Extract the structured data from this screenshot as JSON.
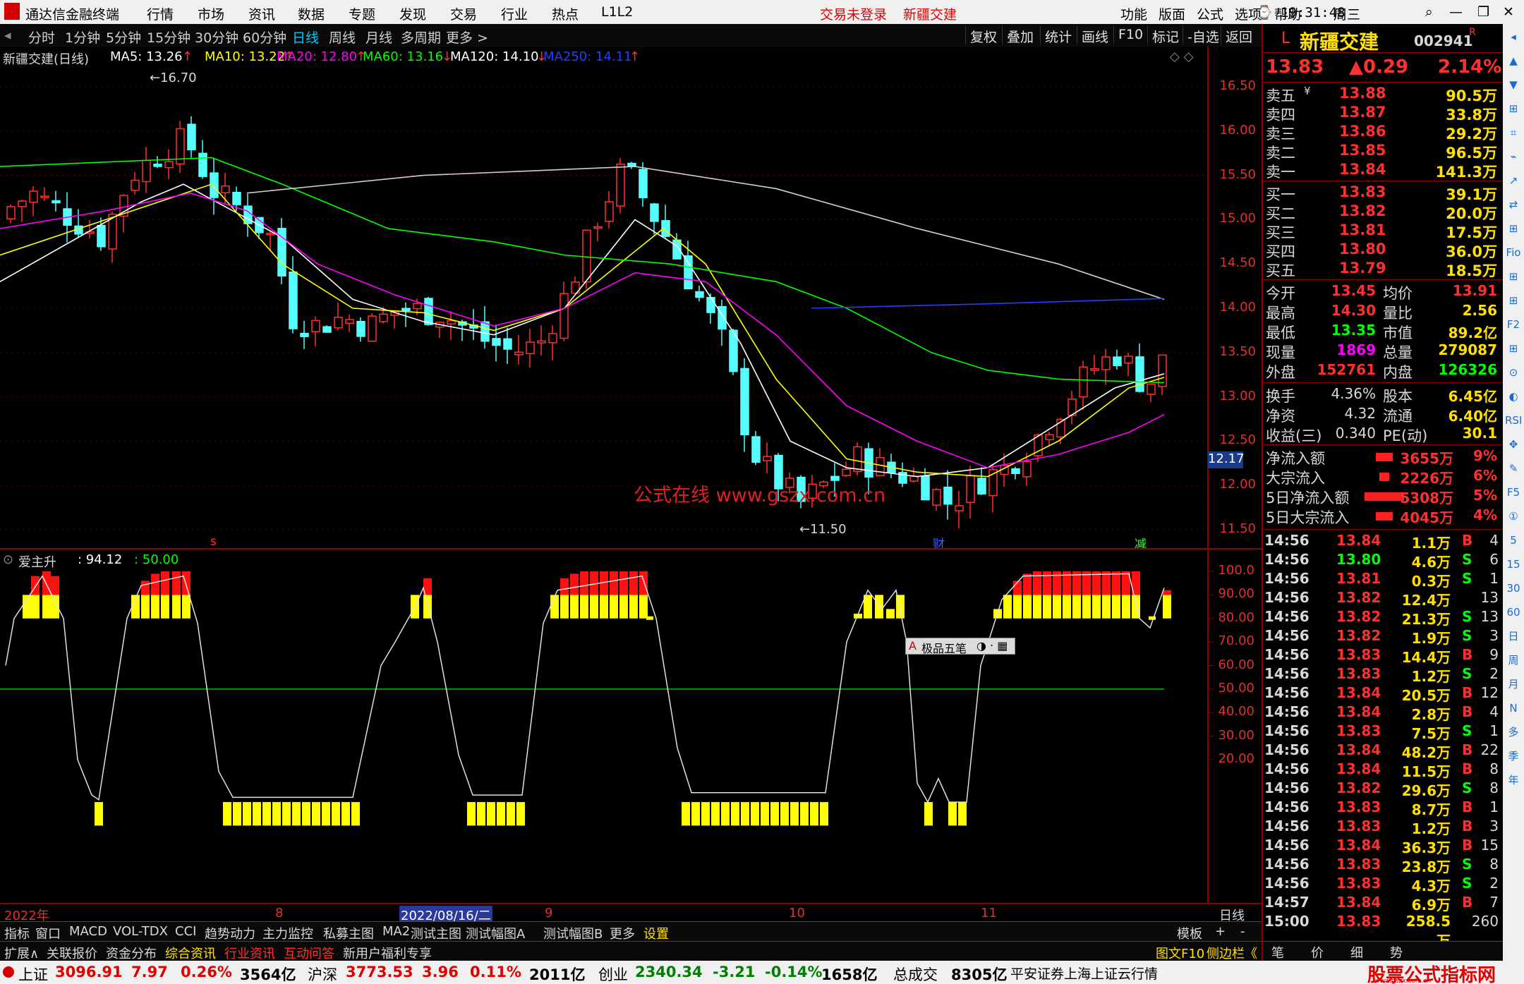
{
  "titlebar": {
    "app": "通达信金融终端",
    "menu": [
      "行情",
      "市场",
      "资讯",
      "数据",
      "专题",
      "发现",
      "交易",
      "行业",
      "热点",
      "L1L2"
    ],
    "trade_status": "交易未登录",
    "stock": "新疆交建",
    "right_menu": [
      "功能",
      "版面",
      "公式",
      "选项",
      "帮助"
    ],
    "time": "19:31:48",
    "weekday": "周三"
  },
  "periods": [
    "分时",
    "1分钟",
    "5分钟",
    "15分钟",
    "30分钟",
    "60分钟",
    "日线",
    "周线",
    "月线",
    "多周期",
    "更多 >"
  ],
  "active_period": "日线",
  "toolbar": [
    "复权",
    "叠加",
    "统计",
    "画线",
    "F10",
    "标记",
    "-自选",
    "返回"
  ],
  "chart": {
    "stock_label": "新疆交建(日线)",
    "ma": [
      {
        "label": "MA5: 13.26",
        "color": "#ffffff",
        "arrow": "↑"
      },
      {
        "label": "MA10: 13.22",
        "color": "#ffff00",
        "arrow": "↑"
      },
      {
        "label": "MA20: 12.80",
        "color": "#ff00ff",
        "arrow": "↑"
      },
      {
        "label": "MA60: 13.16",
        "color": "#00ff00",
        "arrow": "↓"
      },
      {
        "label": "MA120: 14.10",
        "color": "#ffffff",
        "arrow": "↓"
      },
      {
        "label": "MA250: 14.11",
        "color": "#2040ff",
        "arrow": "↑"
      }
    ],
    "y_ticks": [
      "16.50",
      "16.00",
      "15.50",
      "15.00",
      "14.50",
      "14.00",
      "13.50",
      "13.00",
      "12.50",
      "12.00",
      "11.50"
    ],
    "cur_price_tag": "12.17",
    "high_mark": "16.70",
    "low_mark": "11.50",
    "watermark": "公式在线  www.gszx.com.cn",
    "markers": {
      "s": "s",
      "cai": "财",
      "jian": "减"
    }
  },
  "indicator": {
    "name": "爱主升",
    "v1": ": 94.12",
    "v2": ": 50.00",
    "y_ticks": [
      "100.0",
      "90.00",
      "80.00",
      "70.00",
      "60.00",
      "50.00",
      "40.00",
      "30.00",
      "20.00"
    ],
    "popup": "极品五笔"
  },
  "xaxis": {
    "labels": [
      "2022年",
      "8",
      "2022/08/16/二",
      "9",
      "10",
      "11"
    ],
    "right": "日线"
  },
  "tabs1": [
    "指标",
    "窗口",
    "MACD",
    "VOL-TDX",
    "CCI",
    "趋势动力",
    "主力监控",
    "私募主图",
    "MA2",
    "测试主图",
    "测试幅图A",
    "测试幅图B",
    "更多",
    "设置"
  ],
  "tabs1_right": [
    "模板",
    "+",
    "-"
  ],
  "tabs2": [
    "扩展∧",
    "关联报价",
    "资金分布",
    "综合资讯",
    "行业资讯",
    "互动问答",
    "新用户福利专享"
  ],
  "tabs2_right": [
    "图文F10",
    "侧边栏《"
  ],
  "quote": {
    "flag": "L",
    "name": "新疆交建",
    "code": "002941",
    "tag": "R",
    "price": "13.83",
    "change": "▲0.29",
    "pct": "2.14%",
    "asks": [
      {
        "l": "卖五",
        "p": "13.88",
        "v": "90.5万"
      },
      {
        "l": "卖四",
        "p": "13.87",
        "v": "33.8万"
      },
      {
        "l": "卖三",
        "p": "13.86",
        "v": "29.2万"
      },
      {
        "l": "卖二",
        "p": "13.85",
        "v": "96.5万"
      },
      {
        "l": "卖一",
        "p": "13.84",
        "v": "141.3万"
      }
    ],
    "bids": [
      {
        "l": "买一",
        "p": "13.83",
        "v": "39.1万"
      },
      {
        "l": "买二",
        "p": "13.82",
        "v": "20.0万"
      },
      {
        "l": "买三",
        "p": "13.81",
        "v": "17.5万"
      },
      {
        "l": "买四",
        "p": "13.80",
        "v": "36.0万"
      },
      {
        "l": "买五",
        "p": "13.79",
        "v": "18.5万"
      }
    ],
    "stats": [
      [
        "今开",
        "13.45",
        "均价",
        "13.91"
      ],
      [
        "最高",
        "14.30",
        "量比",
        "2.56"
      ],
      [
        "最低",
        "13.35",
        "市值",
        "89.2亿"
      ],
      [
        "现量",
        "1869",
        "总量",
        "279087"
      ],
      [
        "外盘",
        "152761",
        "内盘",
        "126326"
      ]
    ],
    "stats2": [
      [
        "换手",
        "4.36%",
        "股本",
        "6.45亿"
      ],
      [
        "净资",
        "4.32",
        "流通",
        "6.40亿"
      ],
      [
        "收益(三)",
        "0.340",
        "PE(动)",
        "30.1"
      ]
    ],
    "flows": [
      [
        "净流入额",
        "3655万",
        "9%"
      ],
      [
        "大宗流入",
        "2226万",
        "6%"
      ],
      [
        "5日净流入额",
        "5308万",
        "5%"
      ],
      [
        "5日大宗流入",
        "4045万",
        "4%"
      ]
    ],
    "ticks": [
      [
        "14:56",
        "13.84",
        "1.1万",
        "B",
        "4"
      ],
      [
        "14:56",
        "13.80",
        "4.6万",
        "S",
        "6"
      ],
      [
        "14:56",
        "13.81",
        "0.3万",
        "S",
        "1"
      ],
      [
        "14:56",
        "13.82",
        "12.4万",
        "",
        "13"
      ],
      [
        "14:56",
        "13.82",
        "21.3万",
        "S",
        "13"
      ],
      [
        "14:56",
        "13.82",
        "1.9万",
        "S",
        "3"
      ],
      [
        "14:56",
        "13.83",
        "14.4万",
        "B",
        "9"
      ],
      [
        "14:56",
        "13.83",
        "1.2万",
        "S",
        "2"
      ],
      [
        "14:56",
        "13.84",
        "20.5万",
        "B",
        "12"
      ],
      [
        "14:56",
        "13.84",
        "2.8万",
        "B",
        "4"
      ],
      [
        "14:56",
        "13.83",
        "7.5万",
        "S",
        "1"
      ],
      [
        "14:56",
        "13.84",
        "48.2万",
        "B",
        "22"
      ],
      [
        "14:56",
        "13.84",
        "11.5万",
        "B",
        "8"
      ],
      [
        "14:56",
        "13.82",
        "29.6万",
        "S",
        "8"
      ],
      [
        "14:56",
        "13.83",
        "8.7万",
        "B",
        "1"
      ],
      [
        "14:56",
        "13.83",
        "1.2万",
        "B",
        "3"
      ],
      [
        "14:56",
        "13.84",
        "36.3万",
        "B",
        "15"
      ],
      [
        "14:56",
        "13.83",
        "23.8万",
        "S",
        "8"
      ],
      [
        "14:56",
        "13.83",
        "4.3万",
        "S",
        "2"
      ],
      [
        "14:57",
        "13.84",
        "6.9万",
        "B",
        "7"
      ],
      [
        "15:00",
        "13.83",
        "258.5万",
        "",
        "260"
      ]
    ],
    "bottom_tabs": [
      "笔",
      "价",
      "细",
      "势"
    ]
  },
  "side_icons": [
    "◂",
    "▲",
    "▼",
    "⊞",
    "⌗",
    "⌁",
    "↗",
    "⇄",
    "⊞",
    "Fio",
    "⊞",
    "⊞",
    "F2",
    "⊞",
    "⊙",
    "◐",
    "RSI",
    "✥",
    "✎",
    "F5",
    "①",
    "5",
    "15",
    "30",
    "60",
    "日",
    "周",
    "月",
    "N",
    "多",
    "季",
    "年"
  ],
  "status": {
    "sh_label": "上证",
    "sh_val": "3096.91",
    "sh_chg": "7.97",
    "sh_pct": "0.26%",
    "sh_amt": "3564亿",
    "hs_label": "沪深",
    "hs_val": "3773.53",
    "hs_chg": "3.96",
    "hs_pct": "0.11%",
    "hs_amt": "2011亿",
    "cy_label": "创业",
    "cy_val": "2340.34",
    "cy_chg": "-3.21",
    "cy_pct": "-0.14%",
    "cy_amt": "1658亿",
    "zcj_label": "总成交",
    "zcj_val": "8305亿",
    "info": "平安证券上海上证云行情",
    "logo": "股票公式指标网",
    "logo_url": "www.gszx.com.cn"
  }
}
